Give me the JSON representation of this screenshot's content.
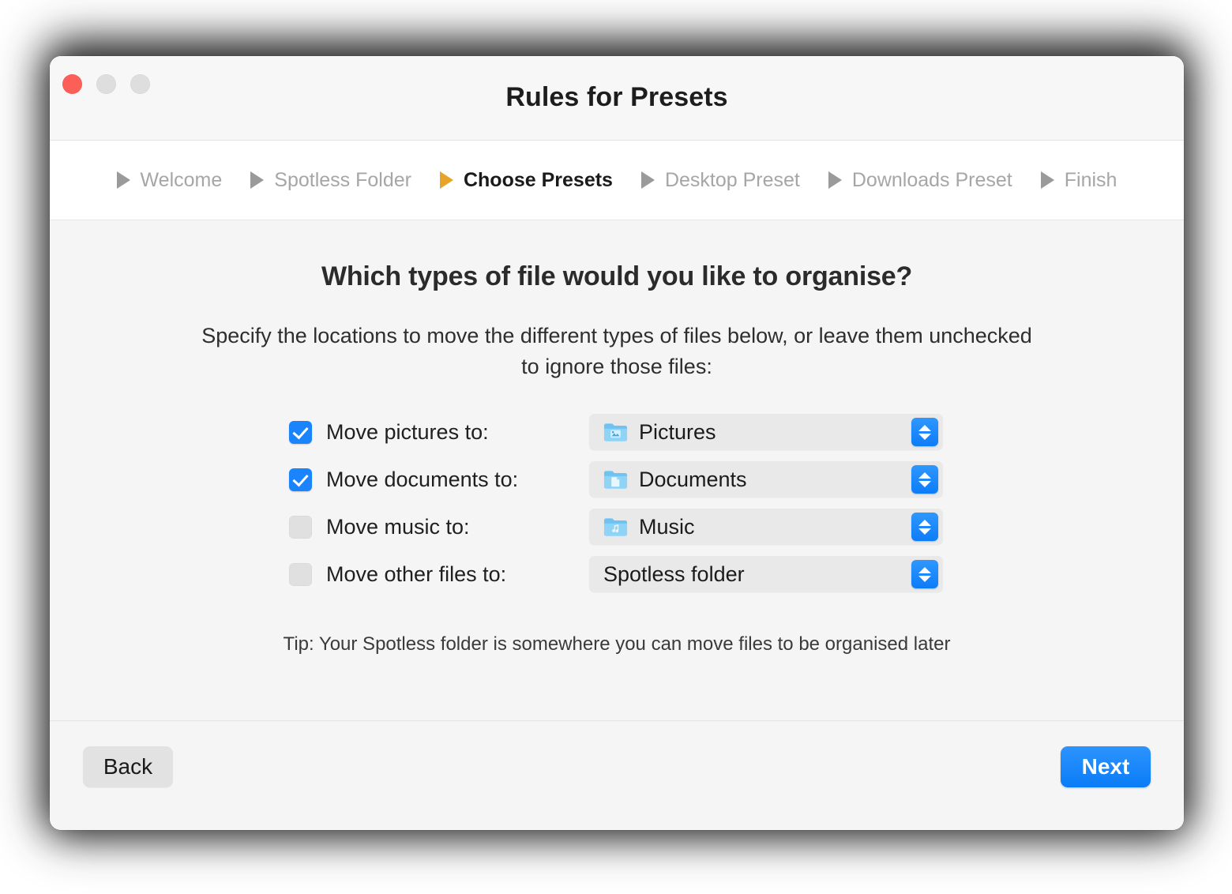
{
  "window": {
    "title": "Rules for Presets",
    "traffic_lights": [
      "close-button",
      "minimize-button",
      "maximize-button"
    ]
  },
  "steps": [
    {
      "label": "Welcome",
      "active": false,
      "arrow_icon": "triangle-right-icon"
    },
    {
      "label": "Spotless Folder",
      "active": false,
      "arrow_icon": "triangle-right-icon"
    },
    {
      "label": "Choose Presets",
      "active": true,
      "arrow_icon": "triangle-right-icon"
    },
    {
      "label": "Desktop Preset",
      "active": false,
      "arrow_icon": "triangle-right-icon"
    },
    {
      "label": "Downloads Preset",
      "active": false,
      "arrow_icon": "triangle-right-icon"
    },
    {
      "label": "Finish",
      "active": false,
      "arrow_icon": "triangle-right-icon"
    }
  ],
  "main": {
    "headline": "Which types of file would you like to organise?",
    "subtext": "Specify the locations to move the different types of files below, or leave them unchecked to ignore those files:",
    "tip": "Tip: Your Spotless folder is somewhere you can move files to be organised later",
    "rows": [
      {
        "label": "Move pictures to:",
        "checked": true,
        "value": "Pictures",
        "icon": "folder-pictures-icon"
      },
      {
        "label": "Move documents to:",
        "checked": true,
        "value": "Documents",
        "icon": "folder-documents-icon"
      },
      {
        "label": "Move music to:",
        "checked": false,
        "value": "Music",
        "icon": "folder-music-icon"
      },
      {
        "label": "Move other files to:",
        "checked": false,
        "value": "Spotless folder",
        "icon": "none"
      }
    ]
  },
  "footer": {
    "back_label": "Back",
    "next_label": "Next"
  },
  "colors": {
    "accent_blue": "#0a7cf7",
    "active_step_arrow": "#e6a429",
    "inactive_text": "#a6a6a6",
    "close_light": "#fc5f57",
    "window_background": "#f5f5f5"
  }
}
